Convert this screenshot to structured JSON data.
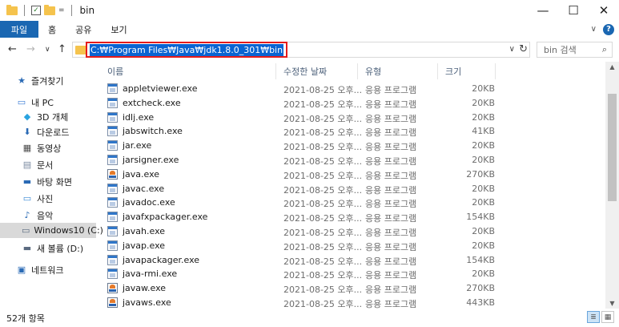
{
  "window": {
    "title": "bin"
  },
  "quick_access": {
    "down_arrow": "="
  },
  "controls": {
    "minimize": "—",
    "maximize": "☐",
    "close": "✕"
  },
  "ribbon": {
    "file_tab": "파일",
    "tabs": [
      "홈",
      "공유",
      "보기"
    ],
    "collapse_icon": "∨",
    "help_icon": "?"
  },
  "nav": {
    "back": "←",
    "forward": "→",
    "recent": "∨",
    "up": "↑"
  },
  "address": {
    "path": "C:₩Program Files₩Java₩jdk1.8.0_301₩bin",
    "dropdown": "∨",
    "refresh": "↻"
  },
  "search": {
    "placeholder": "bin 검색",
    "icon": "⌕"
  },
  "sidebar": {
    "items": [
      {
        "label": "즐겨찾기",
        "icon": "star-icon",
        "glyph": "★",
        "color": "#2a6ab5"
      },
      {
        "label": "내 PC",
        "icon": "computer-icon",
        "glyph": "▭",
        "color": "#3a7bd5"
      },
      {
        "label": "3D 개체",
        "icon": "cube-icon",
        "glyph": "◆",
        "color": "#29a3e0"
      },
      {
        "label": "다운로드",
        "icon": "download-icon",
        "glyph": "⬇",
        "color": "#2a6ab5"
      },
      {
        "label": "동영상",
        "icon": "video-icon",
        "glyph": "▦",
        "color": "#4a4a4a"
      },
      {
        "label": "문서",
        "icon": "document-icon",
        "glyph": "▤",
        "color": "#7a8aa0"
      },
      {
        "label": "바탕 화면",
        "icon": "desktop-icon",
        "glyph": "▬",
        "color": "#2a6ab5"
      },
      {
        "label": "사진",
        "icon": "pictures-icon",
        "glyph": "▭",
        "color": "#3a8ad5"
      },
      {
        "label": "음악",
        "icon": "music-icon",
        "glyph": "♪",
        "color": "#2a6ab5"
      },
      {
        "label": "Windows10 (C:)",
        "icon": "drive-c-icon",
        "glyph": "▭",
        "color": "#5a6a80"
      },
      {
        "label": "새 볼륨 (D:)",
        "icon": "drive-d-icon",
        "glyph": "▬",
        "color": "#5a6a80"
      },
      {
        "label": "네트워크",
        "icon": "network-icon",
        "glyph": "▣",
        "color": "#2a6ab5"
      }
    ]
  },
  "columns": {
    "name": "이름",
    "date": "수정한 날짜",
    "type": "유형",
    "size": "크기",
    "sort_indicator": "^"
  },
  "files": [
    {
      "name": "appletviewer.exe",
      "date": "2021-08-25 오후...",
      "type": "응용 프로그램",
      "size": "20KB",
      "icon": "exe-icon"
    },
    {
      "name": "extcheck.exe",
      "date": "2021-08-25 오후...",
      "type": "응용 프로그램",
      "size": "20KB",
      "icon": "exe-icon"
    },
    {
      "name": "idlj.exe",
      "date": "2021-08-25 오후...",
      "type": "응용 프로그램",
      "size": "20KB",
      "icon": "exe-icon"
    },
    {
      "name": "jabswitch.exe",
      "date": "2021-08-25 오후...",
      "type": "응용 프로그램",
      "size": "41KB",
      "icon": "exe-icon"
    },
    {
      "name": "jar.exe",
      "date": "2021-08-25 오후...",
      "type": "응용 프로그램",
      "size": "20KB",
      "icon": "exe-icon"
    },
    {
      "name": "jarsigner.exe",
      "date": "2021-08-25 오후...",
      "type": "응용 프로그램",
      "size": "20KB",
      "icon": "exe-icon"
    },
    {
      "name": "java.exe",
      "date": "2021-08-25 오후...",
      "type": "응용 프로그램",
      "size": "270KB",
      "icon": "java-icon"
    },
    {
      "name": "javac.exe",
      "date": "2021-08-25 오후...",
      "type": "응용 프로그램",
      "size": "20KB",
      "icon": "exe-icon"
    },
    {
      "name": "javadoc.exe",
      "date": "2021-08-25 오후...",
      "type": "응용 프로그램",
      "size": "20KB",
      "icon": "exe-icon"
    },
    {
      "name": "javafxpackager.exe",
      "date": "2021-08-25 오후...",
      "type": "응용 프로그램",
      "size": "154KB",
      "icon": "exe-icon"
    },
    {
      "name": "javah.exe",
      "date": "2021-08-25 오후...",
      "type": "응용 프로그램",
      "size": "20KB",
      "icon": "exe-icon"
    },
    {
      "name": "javap.exe",
      "date": "2021-08-25 오후...",
      "type": "응용 프로그램",
      "size": "20KB",
      "icon": "exe-icon"
    },
    {
      "name": "javapackager.exe",
      "date": "2021-08-25 오후...",
      "type": "응용 프로그램",
      "size": "154KB",
      "icon": "exe-icon"
    },
    {
      "name": "java-rmi.exe",
      "date": "2021-08-25 오후...",
      "type": "응용 프로그램",
      "size": "20KB",
      "icon": "exe-icon"
    },
    {
      "name": "javaw.exe",
      "date": "2021-08-25 오후...",
      "type": "응용 프로그램",
      "size": "270KB",
      "icon": "java-icon"
    },
    {
      "name": "javaws.exe",
      "date": "2021-08-25 오후...",
      "type": "응용 프로그램",
      "size": "443KB",
      "icon": "java-icon"
    }
  ],
  "status": {
    "item_count": "52개 항목"
  },
  "colors": {
    "accent": "#1a67b2",
    "selection": "#0a64d2",
    "highlight_border": "#e51b1b"
  }
}
